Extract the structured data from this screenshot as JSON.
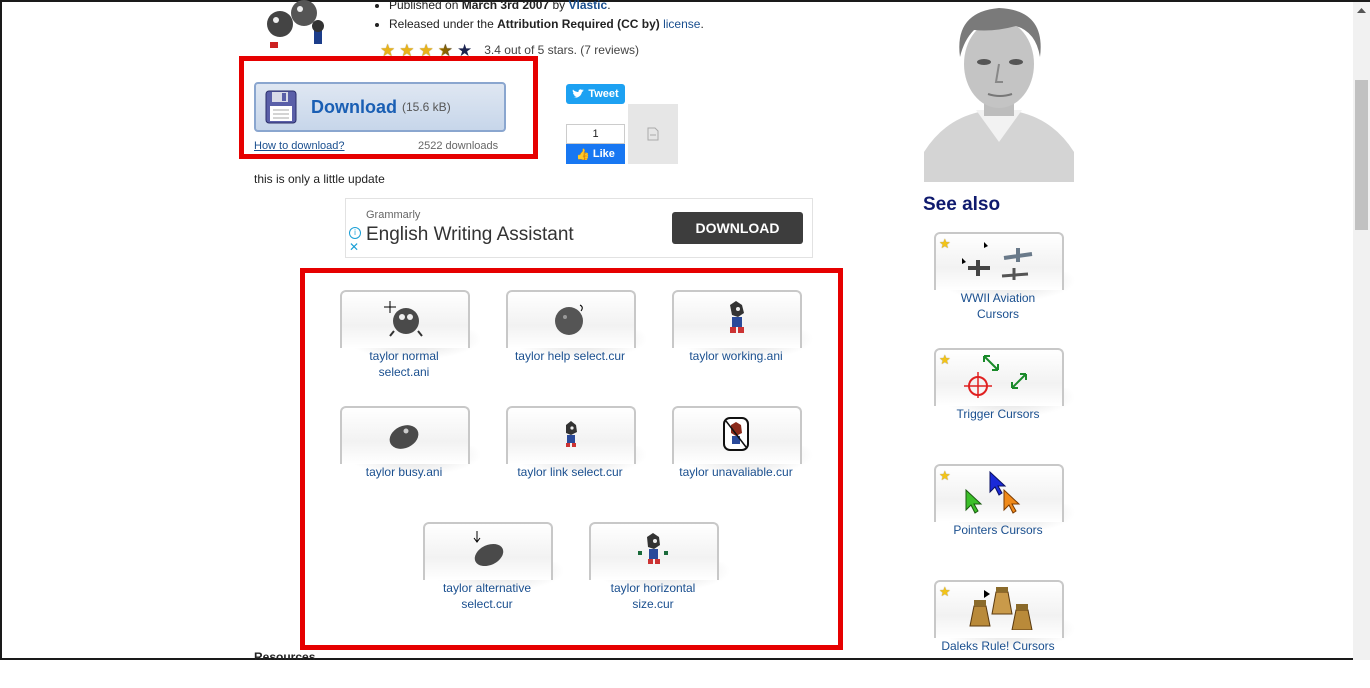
{
  "meta": {
    "published_prefix": "Published on",
    "published_date": "March 3rd 2007",
    "published_by": "by",
    "author": "Vlastic",
    "released_prefix": "Released under the",
    "license_name": "Attribution Required (CC by)",
    "license_link": "license",
    "period": ".",
    "rating_value": 3.4,
    "rating_text": "3.4 out of 5 stars. (7 reviews)"
  },
  "download": {
    "label": "Download",
    "size": "(15.6 kB)",
    "how_to": "How to download?",
    "count": "2522 downloads"
  },
  "social": {
    "tweet": "Tweet",
    "like_count": "1",
    "like": "Like"
  },
  "description": "this is only a little update",
  "ad": {
    "brand": "Grammarly",
    "title": "English Writing Assistant",
    "cta": "DOWNLOAD"
  },
  "cursors": [
    {
      "line1": "taylor normal",
      "line2": "select.ani",
      "icon": "bomb-crosshair-icon"
    },
    {
      "line1": "taylor help select.cur",
      "line2": "",
      "icon": "bomb-icon"
    },
    {
      "line1": "taylor working.ani",
      "line2": "",
      "icon": "hedgehog-icon"
    },
    {
      "line1": "taylor busy.ani",
      "line2": "",
      "icon": "bomb-tilted-icon"
    },
    {
      "line1": "taylor link select.cur",
      "line2": "",
      "icon": "hedgehog-small-icon"
    },
    {
      "line1": "taylor unavaliable.cur",
      "line2": "",
      "icon": "hedgehog-forbidden-icon"
    },
    {
      "line1": "taylor alternative",
      "line2": "select.cur",
      "icon": "bomb-arrow-icon"
    },
    {
      "line1": "taylor horizontal",
      "line2": "size.cur",
      "icon": "hedgehog-resize-icon"
    }
  ],
  "sidebar": {
    "see_also": "See also",
    "items": [
      {
        "line1": "WWII Aviation",
        "line2": "Cursors",
        "icon": "airplanes-icon"
      },
      {
        "line1": "Trigger Cursors",
        "line2": "",
        "icon": "crosshair-icon"
      },
      {
        "line1": "Pointers Cursors",
        "line2": "",
        "icon": "arrow-pointers-icon"
      },
      {
        "line1": "Daleks Rule! Cursors",
        "line2": "",
        "icon": "daleks-icon"
      }
    ]
  },
  "footer": {
    "resources": "Resources"
  },
  "colors": {
    "accent": "#1a4f8f",
    "highlight": "#e60000",
    "see_also": "#0f1a6e",
    "star": "#e8b31a"
  }
}
